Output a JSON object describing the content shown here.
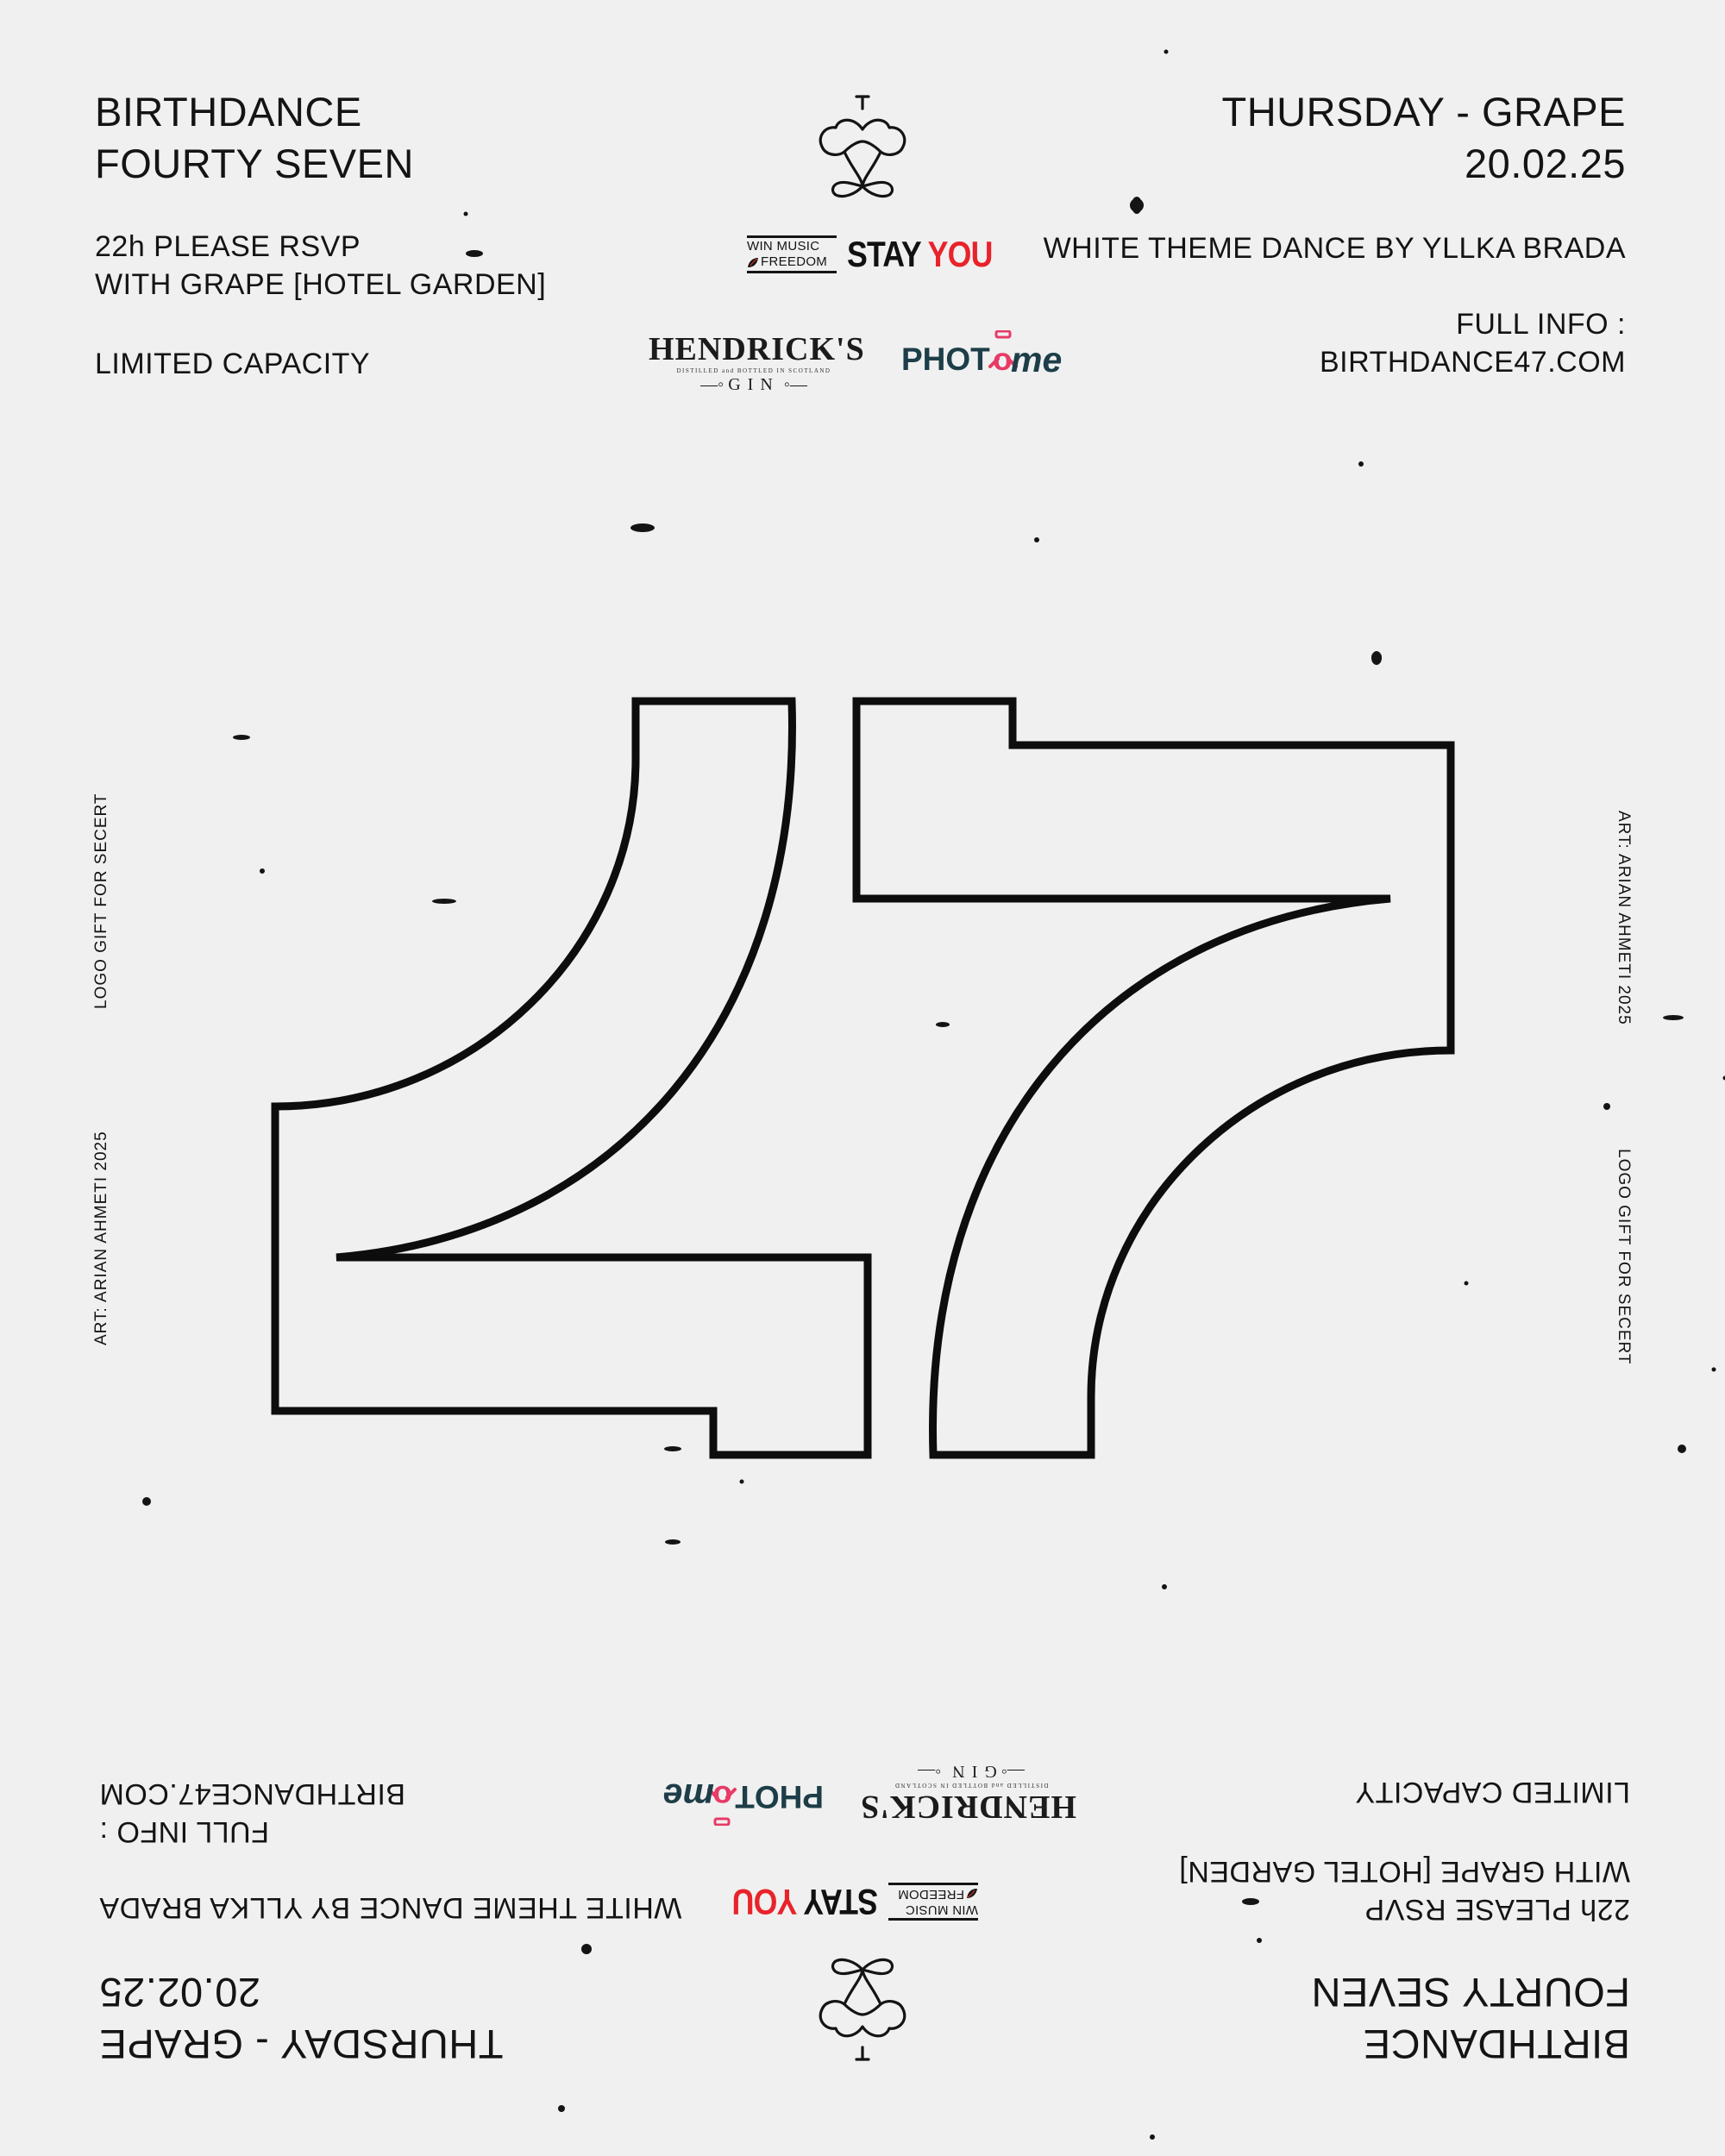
{
  "event": {
    "title_line1": "BIRTHDANCE",
    "title_line2": "FOURTY SEVEN",
    "rsvp_line1": "22h PLEASE RSVP",
    "rsvp_line2": "WITH GRAPE  [HOTEL GARDEN]",
    "capacity": "LIMITED CAPACITY",
    "date_line1": "THURSDAY - GRAPE",
    "date_line2": "20.02.25",
    "theme": "WHITE THEME DANCE BY YLLKA BRADA",
    "info_line1": "FULL INFO :",
    "info_line2": "BIRTHDANCE47.COM",
    "number": "47"
  },
  "sponsors": {
    "win_line1": "WIN MUSIC",
    "win_line2": "FREEDOM",
    "stay_word1": "STAY",
    "stay_word2": "YOU",
    "hendricks_name": "HENDRICK'S",
    "hendricks_sub": "DISTILLED and BOTTLED IN SCOTLAND",
    "hendricks_gin": "GIN",
    "photome_part1": "PHOT",
    "photome_o": "o",
    "photome_part2": "me"
  },
  "credits": {
    "logo_gift": "LOGO GIFT FOR SECERT",
    "art": "ART:  ARIAN AHMETI 2025"
  },
  "colors": {
    "background": "#f0f0f0",
    "ink": "#141414",
    "stay_red": "#e8232b",
    "photome_pink": "#e83a66",
    "photome_teal": "#1d3e48"
  },
  "icons": [
    "heart-spade-emblem-icon",
    "photome-camera-icon"
  ]
}
